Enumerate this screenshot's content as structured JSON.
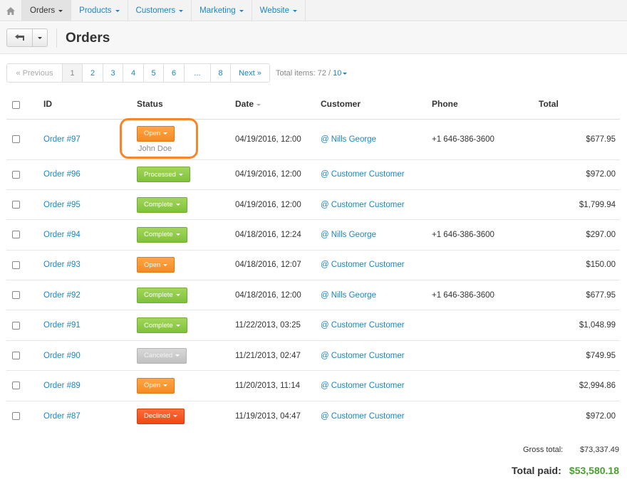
{
  "nav": {
    "items": [
      {
        "label": "Orders"
      },
      {
        "label": "Products"
      },
      {
        "label": "Customers"
      },
      {
        "label": "Marketing"
      },
      {
        "label": "Website"
      }
    ]
  },
  "page": {
    "title": "Orders"
  },
  "pagination": {
    "previous": "« Previous",
    "pages": [
      "1",
      "2",
      "3",
      "4",
      "5",
      "6",
      "...",
      "8"
    ],
    "next": "Next »",
    "total_label": "Total items: 72 /",
    "per_page": "10"
  },
  "table": {
    "headers": {
      "id": "ID",
      "status": "Status",
      "date": "Date",
      "customer": "Customer",
      "phone": "Phone",
      "total": "Total"
    },
    "rows": [
      {
        "id": "Order #97",
        "status": "Open",
        "status_type": "open",
        "issuer": "John Doe",
        "date": "04/19/2016, 12:00",
        "customer": "Nills George",
        "phone": "+1 646-386-3600",
        "total": "$677.95"
      },
      {
        "id": "Order #96",
        "status": "Processed",
        "status_type": "processed",
        "date": "04/19/2016, 12:00",
        "customer": "Customer Customer",
        "phone": "",
        "total": "$972.00"
      },
      {
        "id": "Order #95",
        "status": "Complete",
        "status_type": "complete",
        "date": "04/19/2016, 12:00",
        "customer": "Customer Customer",
        "phone": "",
        "total": "$1,799.94"
      },
      {
        "id": "Order #94",
        "status": "Complete",
        "status_type": "complete",
        "date": "04/18/2016, 12:24",
        "customer": "Nills George",
        "phone": "+1 646-386-3600",
        "total": "$297.00"
      },
      {
        "id": "Order #93",
        "status": "Open",
        "status_type": "open",
        "date": "04/18/2016, 12:07",
        "customer": "Customer Customer",
        "phone": "",
        "total": "$150.00"
      },
      {
        "id": "Order #92",
        "status": "Complete",
        "status_type": "complete",
        "date": "04/18/2016, 12:00",
        "customer": "Nills George",
        "phone": "+1 646-386-3600",
        "total": "$677.95"
      },
      {
        "id": "Order #91",
        "status": "Complete",
        "status_type": "complete",
        "date": "11/22/2013, 03:25",
        "customer": "Customer Customer",
        "phone": "",
        "total": "$1,048.99"
      },
      {
        "id": "Order #90",
        "status": "Canceled",
        "status_type": "canceled",
        "date": "11/21/2013, 02:47",
        "customer": "Customer Customer",
        "phone": "",
        "total": "$749.95"
      },
      {
        "id": "Order #89",
        "status": "Open",
        "status_type": "open",
        "date": "11/20/2013, 11:14",
        "customer": "Customer Customer",
        "phone": "",
        "total": "$2,994.86"
      },
      {
        "id": "Order #87",
        "status": "Declined",
        "status_type": "declined",
        "date": "11/19/2013, 04:47",
        "customer": "Customer Customer",
        "phone": "",
        "total": "$972.00"
      }
    ]
  },
  "totals": {
    "gross_label": "Gross total:",
    "gross_value": "$73,337.49",
    "paid_label": "Total paid:",
    "paid_value": "$53,580.18"
  },
  "colors": {
    "link": "#1a87c4",
    "paid": "#4a9e2f",
    "highlight": "#f5862a"
  }
}
